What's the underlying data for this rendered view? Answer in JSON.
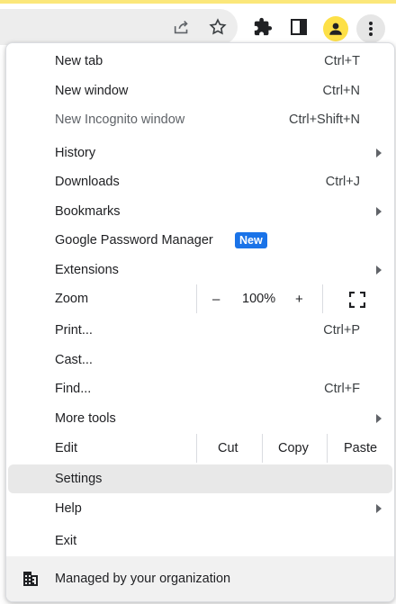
{
  "colors": {
    "accent": "#fbe77a",
    "badge": "#1a73e8",
    "avatar": "#fde047",
    "highlight": "#e8e8e8"
  },
  "toolbar": {
    "icons": [
      "share-icon",
      "bookmark-star-icon",
      "extensions-puzzle-icon",
      "side-panel-icon",
      "profile-avatar-icon",
      "menu-kebab-icon"
    ]
  },
  "menu": {
    "new_tab": {
      "label": "New tab",
      "accel": "Ctrl+T"
    },
    "new_window": {
      "label": "New window",
      "accel": "Ctrl+N"
    },
    "new_incognito": {
      "label": "New Incognito window",
      "accel": "Ctrl+Shift+N"
    },
    "history": {
      "label": "History"
    },
    "downloads": {
      "label": "Downloads",
      "accel": "Ctrl+J"
    },
    "bookmarks": {
      "label": "Bookmarks"
    },
    "password_manager": {
      "label": "Google Password Manager",
      "badge": "New"
    },
    "extensions": {
      "label": "Extensions"
    },
    "zoom": {
      "label": "Zoom",
      "minus": "–",
      "value": "100%",
      "plus": "+",
      "fullscreen_icon": "fullscreen-icon"
    },
    "print": {
      "label": "Print...",
      "accel": "Ctrl+P"
    },
    "cast": {
      "label": "Cast..."
    },
    "find": {
      "label": "Find...",
      "accel": "Ctrl+F"
    },
    "more_tools": {
      "label": "More tools"
    },
    "edit": {
      "label": "Edit",
      "cut": "Cut",
      "copy": "Copy",
      "paste": "Paste"
    },
    "settings": {
      "label": "Settings"
    },
    "help": {
      "label": "Help"
    },
    "exit": {
      "label": "Exit"
    },
    "managed": {
      "label": "Managed by your organization",
      "icon": "building-icon"
    }
  }
}
